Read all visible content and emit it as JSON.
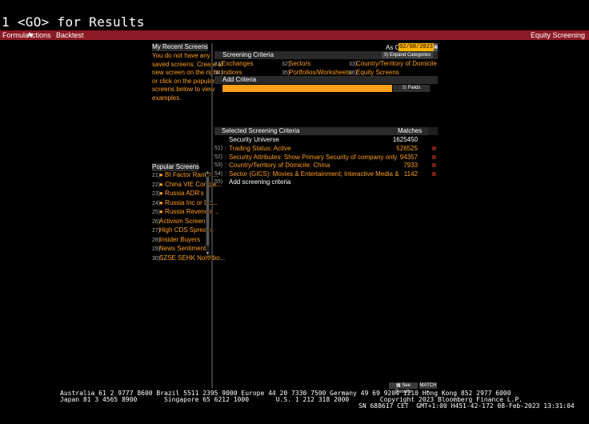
{
  "command": {
    "text": "1 <GO> for Results"
  },
  "menubar": {
    "formula": "Formula",
    "actions": "Actions",
    "backtest": "Backtest",
    "function_name": "Equity Screening"
  },
  "recent": {
    "title": "My Recent Screens",
    "message": [
      "You do not have any",
      "saved screens. Create a",
      "new screen on the right",
      "or click on the popular",
      "screens below to view",
      "examples."
    ]
  },
  "popular": {
    "title": "Popular Screens",
    "items": [
      {
        "num": "21)",
        "label": "● BI Factor Rankin..."
      },
      {
        "num": "22)",
        "label": "● China VIE Compa..."
      },
      {
        "num": "23)",
        "label": "● Russia ADR's"
      },
      {
        "num": "24)",
        "label": "● Russia Inc or Do..."
      },
      {
        "num": "25)",
        "label": "● Russia Revenue ..."
      },
      {
        "num": "26)",
        "label": "Activism Screen"
      },
      {
        "num": "27)",
        "label": "High CDS Spreads"
      },
      {
        "num": "28)",
        "label": "Insider Buyers"
      },
      {
        "num": "29)",
        "label": "News Sentiment"
      },
      {
        "num": "30)",
        "label": "SZSE SEHK Northbo..."
      }
    ]
  },
  "asof": {
    "label": "As Of",
    "date": "02/08/2023"
  },
  "criteria": {
    "title": "Screening Criteria",
    "expand": "Expand Categories",
    "expand_num": "9)",
    "items": [
      {
        "num": "31)",
        "label": "Exchanges"
      },
      {
        "num": "32)",
        "label": "Sectors"
      },
      {
        "num": "33)",
        "label": "Country/Territory of Domicile"
      },
      {
        "num": "34)",
        "label": "Indices"
      },
      {
        "num": "35)",
        "label": "Portfolios/Worksheets"
      },
      {
        "num": "36)",
        "label": "Equity Screens"
      }
    ]
  },
  "add_criteria": {
    "title": "Add Criteria",
    "fields_num": "3)",
    "fields_label": "Fields"
  },
  "selected": {
    "title": "Selected Screening Criteria",
    "matches_label": "Matches",
    "universe_label": "Security Universe",
    "universe_count": "1625450",
    "rows": [
      {
        "num": "51)",
        "label": "Trading Status: Active",
        "count": "526525"
      },
      {
        "num": "52)",
        "label": "Security Attributes: Show Primary Security of company only",
        "count": "94357"
      },
      {
        "num": "53)",
        "label": "Country/Territory of Domicile: China",
        "count": "7933"
      },
      {
        "num": "54)",
        "label": "Sector (GICS): Movies & Entertainment; Interactive Media & Services;...",
        "count": "1142"
      }
    ],
    "add_num": "55)",
    "add_label": "Add screening criteria"
  },
  "buttons": {
    "see_results": "See Results",
    "match": "MATCH"
  },
  "footer": {
    "line1": "Australia 61 2 9777 8600 Brazil 5511 2395 9000 Europe 44 20 7330 7500 Germany 49 69 9204 1210 Hong Kong 852 2977 6000",
    "line2": "Japan 81 3 4565 8900       Singapore 65 6212 1000       U.S. 1 212 318 2000        Copyright 2023 Bloomberg Finance L.P.",
    "line3": "SN 688617 CET  GMT+1:00 H451-42-172 08-Feb-2023 13:31:04"
  }
}
